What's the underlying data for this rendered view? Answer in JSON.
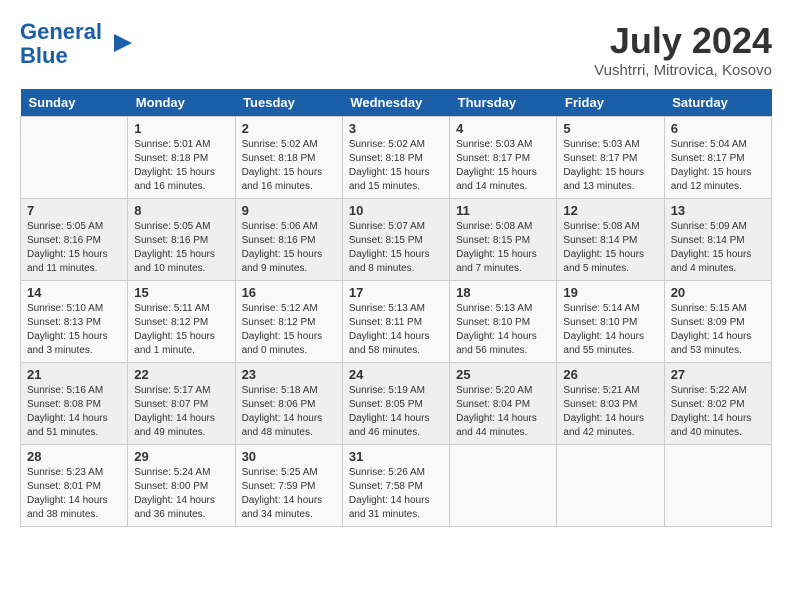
{
  "header": {
    "logo_line1": "General",
    "logo_line2": "Blue",
    "month_title": "July 2024",
    "location": "Vushtrri, Mitrovica, Kosovo"
  },
  "weekdays": [
    "Sunday",
    "Monday",
    "Tuesday",
    "Wednesday",
    "Thursday",
    "Friday",
    "Saturday"
  ],
  "weeks": [
    [
      {
        "day": "",
        "sunrise": "",
        "sunset": "",
        "daylight": ""
      },
      {
        "day": "1",
        "sunrise": "Sunrise: 5:01 AM",
        "sunset": "Sunset: 8:18 PM",
        "daylight": "Daylight: 15 hours and 16 minutes."
      },
      {
        "day": "2",
        "sunrise": "Sunrise: 5:02 AM",
        "sunset": "Sunset: 8:18 PM",
        "daylight": "Daylight: 15 hours and 16 minutes."
      },
      {
        "day": "3",
        "sunrise": "Sunrise: 5:02 AM",
        "sunset": "Sunset: 8:18 PM",
        "daylight": "Daylight: 15 hours and 15 minutes."
      },
      {
        "day": "4",
        "sunrise": "Sunrise: 5:03 AM",
        "sunset": "Sunset: 8:17 PM",
        "daylight": "Daylight: 15 hours and 14 minutes."
      },
      {
        "day": "5",
        "sunrise": "Sunrise: 5:03 AM",
        "sunset": "Sunset: 8:17 PM",
        "daylight": "Daylight: 15 hours and 13 minutes."
      },
      {
        "day": "6",
        "sunrise": "Sunrise: 5:04 AM",
        "sunset": "Sunset: 8:17 PM",
        "daylight": "Daylight: 15 hours and 12 minutes."
      }
    ],
    [
      {
        "day": "7",
        "sunrise": "Sunrise: 5:05 AM",
        "sunset": "Sunset: 8:16 PM",
        "daylight": "Daylight: 15 hours and 11 minutes."
      },
      {
        "day": "8",
        "sunrise": "Sunrise: 5:05 AM",
        "sunset": "Sunset: 8:16 PM",
        "daylight": "Daylight: 15 hours and 10 minutes."
      },
      {
        "day": "9",
        "sunrise": "Sunrise: 5:06 AM",
        "sunset": "Sunset: 8:16 PM",
        "daylight": "Daylight: 15 hours and 9 minutes."
      },
      {
        "day": "10",
        "sunrise": "Sunrise: 5:07 AM",
        "sunset": "Sunset: 8:15 PM",
        "daylight": "Daylight: 15 hours and 8 minutes."
      },
      {
        "day": "11",
        "sunrise": "Sunrise: 5:08 AM",
        "sunset": "Sunset: 8:15 PM",
        "daylight": "Daylight: 15 hours and 7 minutes."
      },
      {
        "day": "12",
        "sunrise": "Sunrise: 5:08 AM",
        "sunset": "Sunset: 8:14 PM",
        "daylight": "Daylight: 15 hours and 5 minutes."
      },
      {
        "day": "13",
        "sunrise": "Sunrise: 5:09 AM",
        "sunset": "Sunset: 8:14 PM",
        "daylight": "Daylight: 15 hours and 4 minutes."
      }
    ],
    [
      {
        "day": "14",
        "sunrise": "Sunrise: 5:10 AM",
        "sunset": "Sunset: 8:13 PM",
        "daylight": "Daylight: 15 hours and 3 minutes."
      },
      {
        "day": "15",
        "sunrise": "Sunrise: 5:11 AM",
        "sunset": "Sunset: 8:12 PM",
        "daylight": "Daylight: 15 hours and 1 minute."
      },
      {
        "day": "16",
        "sunrise": "Sunrise: 5:12 AM",
        "sunset": "Sunset: 8:12 PM",
        "daylight": "Daylight: 15 hours and 0 minutes."
      },
      {
        "day": "17",
        "sunrise": "Sunrise: 5:13 AM",
        "sunset": "Sunset: 8:11 PM",
        "daylight": "Daylight: 14 hours and 58 minutes."
      },
      {
        "day": "18",
        "sunrise": "Sunrise: 5:13 AM",
        "sunset": "Sunset: 8:10 PM",
        "daylight": "Daylight: 14 hours and 56 minutes."
      },
      {
        "day": "19",
        "sunrise": "Sunrise: 5:14 AM",
        "sunset": "Sunset: 8:10 PM",
        "daylight": "Daylight: 14 hours and 55 minutes."
      },
      {
        "day": "20",
        "sunrise": "Sunrise: 5:15 AM",
        "sunset": "Sunset: 8:09 PM",
        "daylight": "Daylight: 14 hours and 53 minutes."
      }
    ],
    [
      {
        "day": "21",
        "sunrise": "Sunrise: 5:16 AM",
        "sunset": "Sunset: 8:08 PM",
        "daylight": "Daylight: 14 hours and 51 minutes."
      },
      {
        "day": "22",
        "sunrise": "Sunrise: 5:17 AM",
        "sunset": "Sunset: 8:07 PM",
        "daylight": "Daylight: 14 hours and 49 minutes."
      },
      {
        "day": "23",
        "sunrise": "Sunrise: 5:18 AM",
        "sunset": "Sunset: 8:06 PM",
        "daylight": "Daylight: 14 hours and 48 minutes."
      },
      {
        "day": "24",
        "sunrise": "Sunrise: 5:19 AM",
        "sunset": "Sunset: 8:05 PM",
        "daylight": "Daylight: 14 hours and 46 minutes."
      },
      {
        "day": "25",
        "sunrise": "Sunrise: 5:20 AM",
        "sunset": "Sunset: 8:04 PM",
        "daylight": "Daylight: 14 hours and 44 minutes."
      },
      {
        "day": "26",
        "sunrise": "Sunrise: 5:21 AM",
        "sunset": "Sunset: 8:03 PM",
        "daylight": "Daylight: 14 hours and 42 minutes."
      },
      {
        "day": "27",
        "sunrise": "Sunrise: 5:22 AM",
        "sunset": "Sunset: 8:02 PM",
        "daylight": "Daylight: 14 hours and 40 minutes."
      }
    ],
    [
      {
        "day": "28",
        "sunrise": "Sunrise: 5:23 AM",
        "sunset": "Sunset: 8:01 PM",
        "daylight": "Daylight: 14 hours and 38 minutes."
      },
      {
        "day": "29",
        "sunrise": "Sunrise: 5:24 AM",
        "sunset": "Sunset: 8:00 PM",
        "daylight": "Daylight: 14 hours and 36 minutes."
      },
      {
        "day": "30",
        "sunrise": "Sunrise: 5:25 AM",
        "sunset": "Sunset: 7:59 PM",
        "daylight": "Daylight: 14 hours and 34 minutes."
      },
      {
        "day": "31",
        "sunrise": "Sunrise: 5:26 AM",
        "sunset": "Sunset: 7:58 PM",
        "daylight": "Daylight: 14 hours and 31 minutes."
      },
      {
        "day": "",
        "sunrise": "",
        "sunset": "",
        "daylight": ""
      },
      {
        "day": "",
        "sunrise": "",
        "sunset": "",
        "daylight": ""
      },
      {
        "day": "",
        "sunrise": "",
        "sunset": "",
        "daylight": ""
      }
    ]
  ]
}
